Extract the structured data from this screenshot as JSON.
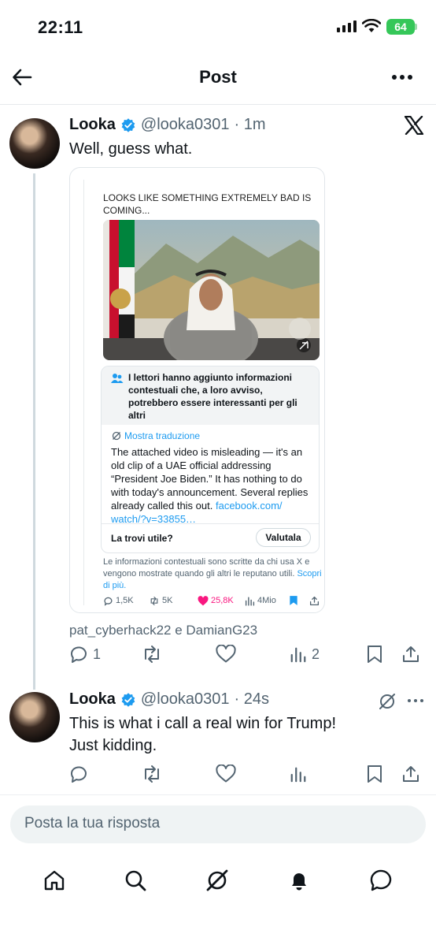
{
  "status": {
    "time": "22:11",
    "battery": "64"
  },
  "header": {
    "title": "Post"
  },
  "tweet1": {
    "name": "Looka",
    "handle": "@looka0301",
    "time": "· 1m",
    "text": "Well, guess what.",
    "quote": {
      "text": "LOOKS LIKE SOMETHING EXTREMELY BAD IS COMING...",
      "note_title": "I lettori hanno aggiunto informazioni contestuali che, a loro avviso, potrebbero essere interessanti per gli altri",
      "translate": "Mostra traduzione",
      "note_body": "The attached video is misleading — it's an old clip of a UAE official addressing “President Joe Biden.” It has nothing to do with today's announcement. Several replies already called this out.",
      "note_link": "facebook.com/ watch/?v=33855…",
      "useful_q": "La trovi utile?",
      "rate_label": "Valutala",
      "footer": "Le informazioni contestuali sono scritte da chi usa X e vengono mostrate quando gli altri le reputano utili.",
      "footer_link": "Scopri di più.",
      "stats": {
        "replies": "1,5K",
        "reposts": "5K",
        "likes": "25,8K",
        "views": "4Mio"
      }
    },
    "mentions": "pat_cyberhack22 e DamianG23",
    "stats": {
      "replies": "1",
      "views": "2"
    }
  },
  "tweet2": {
    "name": "Looka",
    "handle": "@looka0301",
    "time": "· 24s",
    "text_line1": "This is what i call a real win for Trump!",
    "text_line2": "Just kidding."
  },
  "reply": {
    "placeholder": "Posta la tua risposta"
  },
  "colors": {
    "accent": "#1d9bf0",
    "like": "#f91880",
    "battery": "#35c759"
  },
  "icons": [
    "back-arrow-icon",
    "more-icon",
    "x-logo-icon",
    "verified-icon",
    "grok-icon",
    "reply-icon",
    "repost-icon",
    "like-icon",
    "views-icon",
    "bookmark-icon",
    "share-icon",
    "home-icon",
    "search-icon",
    "bell-icon",
    "messages-icon"
  ]
}
